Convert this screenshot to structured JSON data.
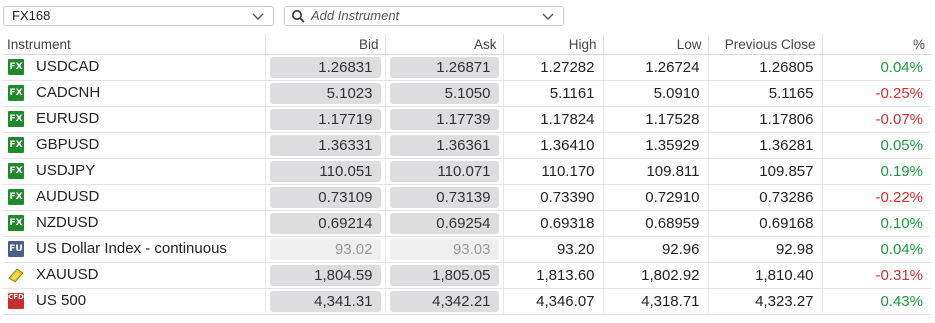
{
  "toolbar": {
    "list_select": "FX168",
    "search_placeholder": "Add Instrument"
  },
  "columns": [
    "Instrument",
    "Bid",
    "Ask",
    "High",
    "Low",
    "Previous Close",
    "%"
  ],
  "rows": [
    {
      "icon": "FX",
      "icon_name": "fx-icon",
      "name": "USDCAD",
      "bid": "1.26831",
      "ask": "1.26871",
      "high": "1.27282",
      "low": "1.26724",
      "prev": "1.26805",
      "pct": "0.04%",
      "dir": "pos"
    },
    {
      "icon": "FX",
      "icon_name": "fx-icon",
      "name": "CADCNH",
      "bid": "5.1023",
      "ask": "5.1050",
      "high": "5.1161",
      "low": "5.0910",
      "prev": "5.1165",
      "pct": "-0.25%",
      "dir": "neg"
    },
    {
      "icon": "FX",
      "icon_name": "fx-icon",
      "name": "EURUSD",
      "bid": "1.17719",
      "ask": "1.17739",
      "high": "1.17824",
      "low": "1.17528",
      "prev": "1.17806",
      "pct": "-0.07%",
      "dir": "neg"
    },
    {
      "icon": "FX",
      "icon_name": "fx-icon",
      "name": "GBPUSD",
      "bid": "1.36331",
      "ask": "1.36361",
      "high": "1.36410",
      "low": "1.35929",
      "prev": "1.36281",
      "pct": "0.05%",
      "dir": "pos"
    },
    {
      "icon": "FX",
      "icon_name": "fx-icon",
      "name": "USDJPY",
      "bid": "110.051",
      "ask": "110.071",
      "high": "110.170",
      "low": "109.811",
      "prev": "109.857",
      "pct": "0.19%",
      "dir": "pos"
    },
    {
      "icon": "FX",
      "icon_name": "fx-icon",
      "name": "AUDUSD",
      "bid": "0.73109",
      "ask": "0.73139",
      "high": "0.73390",
      "low": "0.72910",
      "prev": "0.73286",
      "pct": "-0.22%",
      "dir": "neg"
    },
    {
      "icon": "FX",
      "icon_name": "fx-icon",
      "name": "NZDUSD",
      "bid": "0.69214",
      "ask": "0.69254",
      "high": "0.69318",
      "low": "0.68959",
      "prev": "0.69168",
      "pct": "0.10%",
      "dir": "pos"
    },
    {
      "icon": "FU",
      "icon_name": "futures-icon",
      "name": "US Dollar Index - continuous",
      "bid": "93.02",
      "ask": "93.03",
      "high": "93.20",
      "low": "92.96",
      "prev": "92.98",
      "pct": "0.04%",
      "dir": "pos",
      "dim": true
    },
    {
      "icon": "",
      "icon_name": "gold-bar-icon",
      "name": "XAUUSD",
      "bid": "1,804.59",
      "ask": "1,805.05",
      "high": "1,813.60",
      "low": "1,802.92",
      "prev": "1,810.40",
      "pct": "-0.31%",
      "dir": "neg"
    },
    {
      "icon": "CFD",
      "icon_name": "cfd-icon",
      "name": "US 500",
      "bid": "4,341.31",
      "ask": "4,342.21",
      "high": "4,346.07",
      "low": "4,318.71",
      "prev": "4,323.27",
      "pct": "0.43%",
      "dir": "pos"
    }
  ],
  "colors": {
    "positive": "#1a9c3a",
    "negative": "#d62e2e",
    "fx_badge": "#1f8a2c",
    "fu_badge": "#4a5f86",
    "cfd_badge": "#c9302c",
    "gold": "#e3c21a"
  }
}
